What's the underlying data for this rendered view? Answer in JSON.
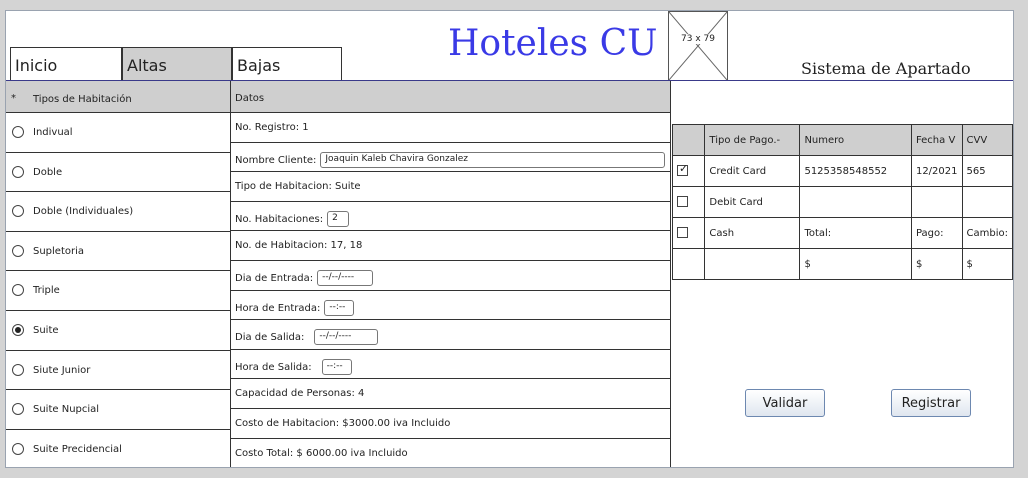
{
  "nav": {
    "tabs": [
      {
        "label": "Inicio"
      },
      {
        "label": "Altas"
      },
      {
        "label": "Bajas"
      }
    ]
  },
  "header": {
    "title": "Hoteles CU",
    "subtitle": "Sistema de Apartado",
    "image_placeholder": "73 x 79"
  },
  "rooms": {
    "header_marker": "*",
    "header": "Tipos de Habitación",
    "items": [
      {
        "label": "Indivual",
        "selected": false
      },
      {
        "label": "Doble",
        "selected": false
      },
      {
        "label": "Doble (Individuales)",
        "selected": false
      },
      {
        "label": "Supletoria",
        "selected": false
      },
      {
        "label": "Triple",
        "selected": false
      },
      {
        "label": "Suite",
        "selected": true
      },
      {
        "label": "Siute Junior",
        "selected": false
      },
      {
        "label": "Suite Nupcial",
        "selected": false
      },
      {
        "label": "Suite Precidencial",
        "selected": false
      }
    ]
  },
  "details": {
    "header": "Datos",
    "registro": "No. Registro: 1",
    "cliente_label": "Nombre Cliente:",
    "cliente_value": "Joaquin Kaleb Chavira Gonzalez",
    "tipo": "Tipo de Habitacion: Suite",
    "num_hab_label": "No. Habitaciones:",
    "num_hab_value": "2",
    "no_hab": "No. de Habitacion: 17, 18",
    "dia_entrada_label": "Dia de Entrada:",
    "dia_entrada_value": "--/--/----",
    "hora_entrada_label": "Hora de Entrada:",
    "hora_entrada_value": "--:--",
    "dia_salida_label": "Dia de Salida:",
    "dia_salida_value": "--/--/----",
    "hora_salida_label": "Hora de Salida:",
    "hora_salida_value": "--:--",
    "capacidad": "Capacidad de Personas: 4",
    "costo_hab": "Costo de Habitacion: $3000.00 iva Incluido",
    "costo_total": "Costo Total: $ 6000.00 iva Incluido"
  },
  "payment": {
    "headers": [
      "Tipo de Pago.-",
      "Numero",
      "Fecha V",
      "CVV"
    ],
    "credit": {
      "label": "Credit Card",
      "numero": "5125358548552",
      "fecha": "12/2021",
      "cvv": "565",
      "checked": true
    },
    "debit": {
      "label": "Debit Card",
      "checked": false
    },
    "cash": {
      "label": "Cash",
      "total_label": "Total:",
      "pago_label": "Pago:",
      "cambio_label": "Cambio:",
      "checked": false
    },
    "totals": {
      "total": "$",
      "pago": "$",
      "cambio": "$"
    }
  },
  "actions": {
    "validate": "Validar",
    "register": "Registrar"
  }
}
